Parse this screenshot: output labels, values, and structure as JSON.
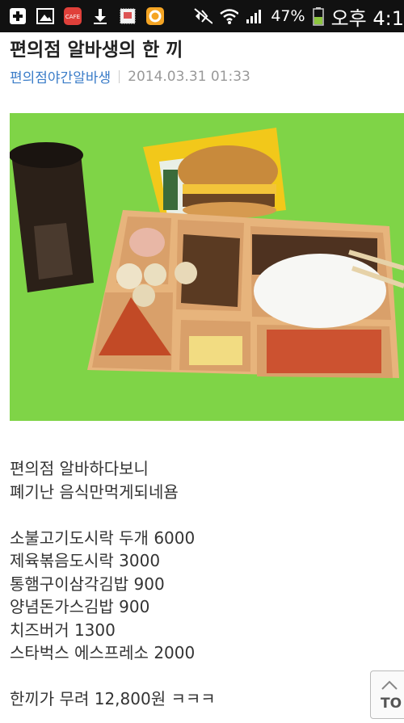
{
  "status_bar": {
    "icons_left": [
      "add-icon",
      "gallery-icon",
      "cafe-app-icon",
      "download-icon",
      "stamp-app-icon",
      "circle-app-icon"
    ],
    "cafe_badge": "CAFE",
    "battery": "47%",
    "clock": "오후 4:1"
  },
  "post": {
    "title": "편의점 알바생의 한 끼",
    "author": "편의점야간알바생",
    "date": "2014.03.31 01:33",
    "lines": [
      "편의점 알바하다보니",
      "폐기난 음식만먹게되네욤",
      "",
      "소불고기도시락 두개 6000",
      "제육볶음도시락 3000",
      "통햄구이삼각김밥 900",
      "양념돈가스김밥 900",
      "치즈버거 1300",
      "스타벅스 에스프레소 2000",
      "",
      "한끼가 무려 12,800원 ㅋㅋㅋ"
    ]
  },
  "top_button": {
    "label": "TO"
  },
  "colors": {
    "author": "#3a7cc8",
    "photo_bg": "#7bd23f",
    "statusbar": "#111111"
  }
}
